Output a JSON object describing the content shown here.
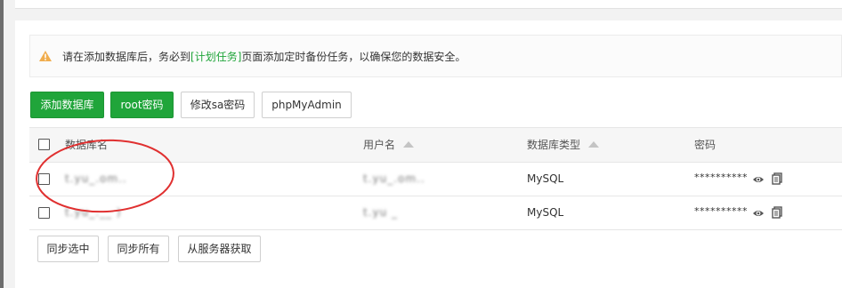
{
  "notice": {
    "text_before": "请在添加数据库后，务必到",
    "link": "[计划任务]",
    "text_after": "页面添加定时备份任务，以确保您的数据安全。"
  },
  "toolbar": {
    "add_db": "添加数据库",
    "root_pwd": "root密码",
    "sa_pwd": "修改sa密码",
    "phpmyadmin": "phpMyAdmin"
  },
  "table": {
    "headers": {
      "name": "数据库名",
      "user": "用户名",
      "type": "数据库类型",
      "password": "密码"
    },
    "rows": [
      {
        "name": "t.yu_.om..",
        "user": "t.yu_.om..",
        "type": "MySQL",
        "password": "**********"
      },
      {
        "name": "t.yu_.__ )",
        "user": "t.yu _",
        "type": "MySQL",
        "password": "**********"
      }
    ]
  },
  "bottom": {
    "sync_selected": "同步选中",
    "sync_all": "同步所有",
    "fetch_server": "从服务器获取"
  },
  "colors": {
    "accent": "#20a53a",
    "warning": "#f0ad4e",
    "annotation": "#e03030"
  }
}
